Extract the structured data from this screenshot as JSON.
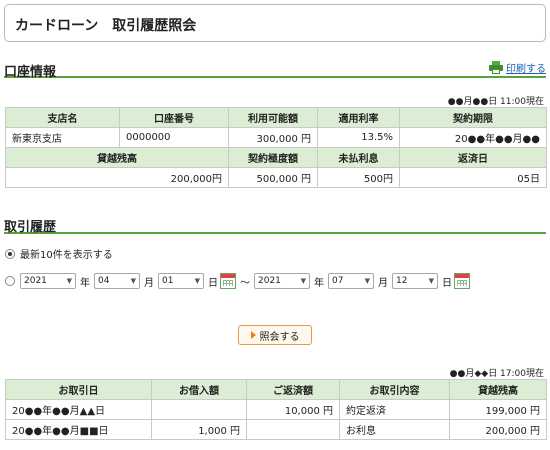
{
  "page_title": "カードローン　取引履歴照会",
  "account": {
    "section_title": "口座情報",
    "print_label": "印刷する",
    "as_of": "●●月●●日 11:00現在",
    "headers1": [
      "支店名",
      "口座番号",
      "利用可能額",
      "適用利率",
      "契約期限"
    ],
    "row1": [
      "新東京支店",
      "0000000",
      "300,000 円",
      "13.5%",
      "20●●年●●月●●"
    ],
    "headers2": [
      "貸越残高",
      "契約極度額",
      "未払利息",
      "返済日"
    ],
    "row2": [
      "200,000円",
      "500,000 円",
      "500円",
      "05日"
    ]
  },
  "history": {
    "section_title": "取引履歴",
    "option_latest": "最新10件を表示する",
    "from": {
      "year": "2021",
      "month": "04",
      "day": "01"
    },
    "to": {
      "year": "2021",
      "month": "07",
      "day": "12"
    },
    "unit_year": "年",
    "unit_month": "月",
    "unit_day": "日",
    "tilde": "～",
    "inquiry_button": "照会する",
    "as_of": "●●月◆◆日 17:00現在",
    "table_headers": [
      "お取引日",
      "お借入額",
      "ご返済額",
      "お取引内容",
      "貸越残高"
    ],
    "rows": [
      [
        "20●●年●●月▲▲日",
        "",
        "10,000 円",
        "約定返済",
        "199,000 円"
      ],
      [
        "20●●年●●月■■日",
        "1,000 円",
        "",
        "お利息",
        "200,000 円"
      ]
    ]
  },
  "colors": {
    "accent_green": "#56a43b",
    "header_bg": "#dbeed4",
    "link_blue": "#1a5fb4",
    "button_orange": "#e39a4a"
  }
}
